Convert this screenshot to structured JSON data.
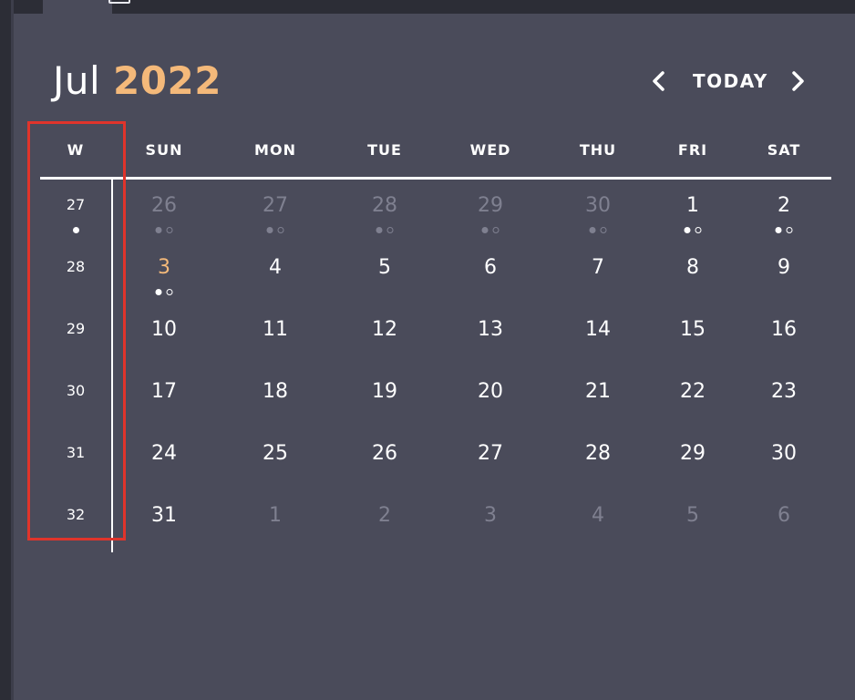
{
  "header": {
    "month": "Jul",
    "year": "2022",
    "today_label": "TODAY",
    "prev_icon": "chevron-left-icon",
    "next_icon": "chevron-right-icon"
  },
  "colors": {
    "background": "#4a4b5a",
    "accent": "#f4b97a",
    "text": "#ffffff",
    "muted": "#7f8090",
    "highlight_box": "#e0342b"
  },
  "weekdays": [
    "W",
    "SUN",
    "MON",
    "TUE",
    "WED",
    "THU",
    "FRI",
    "SAT"
  ],
  "weeks": [
    {
      "week_number": "27",
      "week_dot": true,
      "days": [
        {
          "label": "26",
          "current_month": false,
          "events": true
        },
        {
          "label": "27",
          "current_month": false,
          "events": true
        },
        {
          "label": "28",
          "current_month": false,
          "events": true
        },
        {
          "label": "29",
          "current_month": false,
          "events": true
        },
        {
          "label": "30",
          "current_month": false,
          "events": true
        },
        {
          "label": "1",
          "current_month": true,
          "events": true
        },
        {
          "label": "2",
          "current_month": true,
          "events": true
        }
      ]
    },
    {
      "week_number": "28",
      "week_dot": false,
      "days": [
        {
          "label": "3",
          "current_month": true,
          "today": true,
          "events": true
        },
        {
          "label": "4",
          "current_month": true
        },
        {
          "label": "5",
          "current_month": true
        },
        {
          "label": "6",
          "current_month": true
        },
        {
          "label": "7",
          "current_month": true
        },
        {
          "label": "8",
          "current_month": true
        },
        {
          "label": "9",
          "current_month": true
        }
      ]
    },
    {
      "week_number": "29",
      "week_dot": false,
      "days": [
        {
          "label": "10",
          "current_month": true
        },
        {
          "label": "11",
          "current_month": true
        },
        {
          "label": "12",
          "current_month": true
        },
        {
          "label": "13",
          "current_month": true
        },
        {
          "label": "14",
          "current_month": true
        },
        {
          "label": "15",
          "current_month": true
        },
        {
          "label": "16",
          "current_month": true
        }
      ]
    },
    {
      "week_number": "30",
      "week_dot": false,
      "days": [
        {
          "label": "17",
          "current_month": true
        },
        {
          "label": "18",
          "current_month": true
        },
        {
          "label": "19",
          "current_month": true
        },
        {
          "label": "20",
          "current_month": true
        },
        {
          "label": "21",
          "current_month": true
        },
        {
          "label": "22",
          "current_month": true
        },
        {
          "label": "23",
          "current_month": true
        }
      ]
    },
    {
      "week_number": "31",
      "week_dot": false,
      "days": [
        {
          "label": "24",
          "current_month": true
        },
        {
          "label": "25",
          "current_month": true
        },
        {
          "label": "26",
          "current_month": true
        },
        {
          "label": "27",
          "current_month": true
        },
        {
          "label": "28",
          "current_month": true
        },
        {
          "label": "29",
          "current_month": true
        },
        {
          "label": "30",
          "current_month": true
        }
      ]
    },
    {
      "week_number": "32",
      "week_dot": false,
      "days": [
        {
          "label": "31",
          "current_month": true
        },
        {
          "label": "1",
          "current_month": false
        },
        {
          "label": "2",
          "current_month": false
        },
        {
          "label": "3",
          "current_month": false
        },
        {
          "label": "4",
          "current_month": false
        },
        {
          "label": "5",
          "current_month": false
        },
        {
          "label": "6",
          "current_month": false
        }
      ]
    }
  ]
}
